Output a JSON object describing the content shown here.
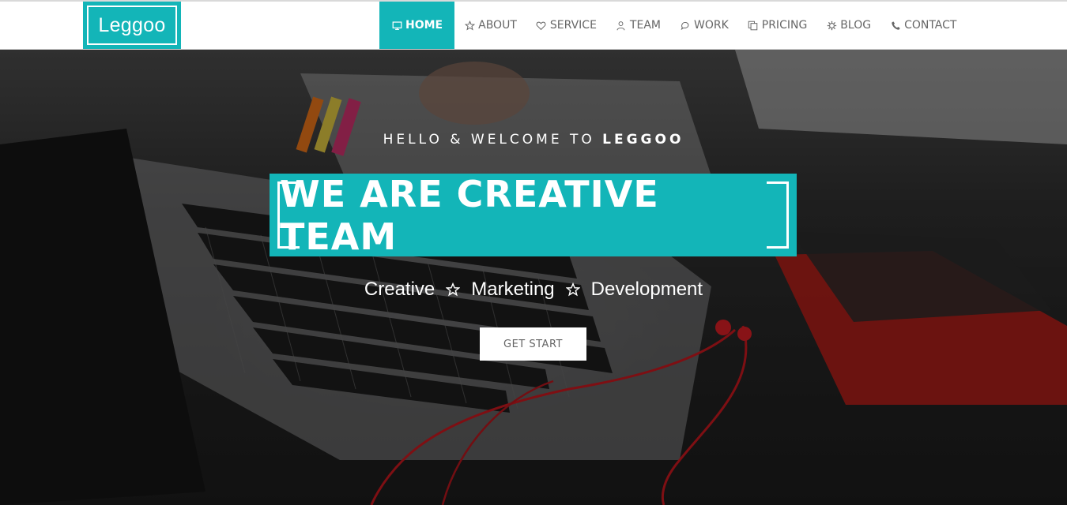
{
  "brand": {
    "name": "Leggoo",
    "accent_color": "#13b5b8"
  },
  "nav": {
    "items": [
      {
        "label": "HOME",
        "icon": "monitor-icon",
        "active": true
      },
      {
        "label": "ABOUT",
        "icon": "star-icon",
        "active": false
      },
      {
        "label": "SERVICE",
        "icon": "heart-icon",
        "active": false
      },
      {
        "label": "TEAM",
        "icon": "user-icon",
        "active": false
      },
      {
        "label": "WORK",
        "icon": "chat-bubble-icon",
        "active": false
      },
      {
        "label": "PRICING",
        "icon": "copy-icon",
        "active": false
      },
      {
        "label": "BLOG",
        "icon": "gear-icon",
        "active": false
      },
      {
        "label": "CONTACT",
        "icon": "phone-icon",
        "active": false
      }
    ]
  },
  "hero": {
    "welcome_prefix": "HELLO & WELCOME TO",
    "welcome_brand": "LEGGOO",
    "headline": "WE ARE CREATIVE TEAM",
    "tagline": [
      "Creative",
      "Marketing",
      "Development"
    ],
    "tagline_separator_icon": "star-outline-icon",
    "cta_label": "GET START",
    "background": "laptop-desk-photo"
  }
}
